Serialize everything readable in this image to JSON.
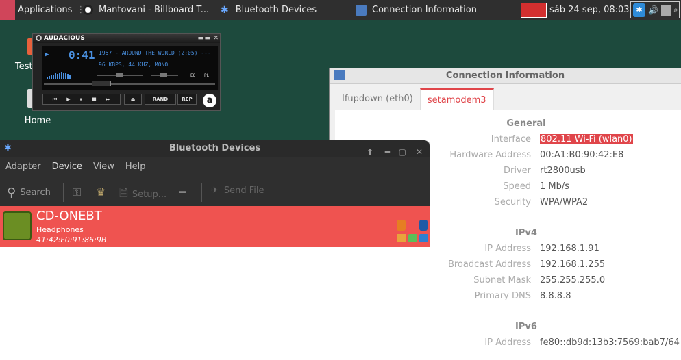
{
  "panel": {
    "applications": "Applications",
    "tasks": [
      {
        "label": "Mantovani - Billboard T..."
      },
      {
        "label": "Bluetooth Devices"
      },
      {
        "label": "Connection Information"
      }
    ],
    "clock": "sáb 24 sep, 08:03"
  },
  "desktop": {
    "icons": [
      {
        "label": "Test"
      },
      {
        "label": "Home"
      }
    ]
  },
  "audacious": {
    "title": "AUDACIOUS",
    "time": "0:41",
    "track": "1957 - AROUND THE WORLD (2:05) ---",
    "info": "96 KBPS, 44 KHZ, MONO",
    "eq_label": "EQ",
    "pl_label": "PL",
    "rand_label": "RAND",
    "rep_label": "REP"
  },
  "connection": {
    "title": "Connection Information",
    "tabs": [
      {
        "label": "Ifupdown (eth0)"
      },
      {
        "label": "setamodem3"
      }
    ],
    "general": {
      "heading": "General",
      "rows": [
        {
          "label": "Interface",
          "value": "802.11 Wi-Fi (wlan0)"
        },
        {
          "label": "Hardware Address",
          "value": "00:A1:B0:90:42:E8"
        },
        {
          "label": "Driver",
          "value": "rt2800usb"
        },
        {
          "label": "Speed",
          "value": "1 Mb/s"
        },
        {
          "label": "Security",
          "value": "WPA/WPA2"
        }
      ]
    },
    "ipv4": {
      "heading": "IPv4",
      "rows": [
        {
          "label": "IP Address",
          "value": "192.168.1.91"
        },
        {
          "label": "Broadcast Address",
          "value": "192.168.1.255"
        },
        {
          "label": "Subnet Mask",
          "value": "255.255.255.0"
        },
        {
          "label": "Primary DNS",
          "value": "8.8.8.8"
        }
      ]
    },
    "ipv6": {
      "heading": "IPv6",
      "rows": [
        {
          "label": "IP Address",
          "value": "fe80::db9d:13b3:7569:bab7/64"
        }
      ]
    }
  },
  "bluetooth": {
    "title": "Bluetooth Devices",
    "menu": [
      "Adapter",
      "Device",
      "View",
      "Help"
    ],
    "toolbar": {
      "search": "Search",
      "setup": "Setup...",
      "send_file": "Send File"
    },
    "device": {
      "name": "CD-ONEBT",
      "type": "Headphones",
      "address": "41:42:F0:91:86:9B"
    }
  },
  "colors": {
    "accent": "#e0454a",
    "selected_row": "#ef5350",
    "desktop": "#1d4a3d"
  }
}
